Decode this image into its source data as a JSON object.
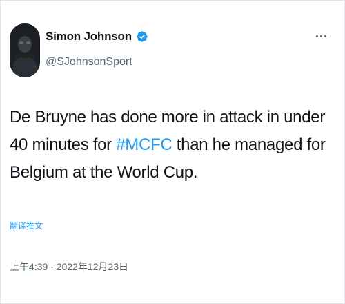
{
  "author": {
    "display_name": "Simon Johnson",
    "handle": "@SJohnsonSport",
    "verified": true
  },
  "tweet": {
    "text_before": "De Bruyne has done more in attack in under 40 minutes for ",
    "hashtag": "#MCFC",
    "text_after": " than he managed for Belgium at the World Cup.",
    "translate_label": "翻译推文",
    "timestamp": "上午4:39 · 2022年12月23日"
  },
  "icons": {
    "verified": "verified-badge-icon",
    "more": "more-options-icon"
  },
  "colors": {
    "accent": "#1d9bf0",
    "text_primary": "#0f1419",
    "text_secondary": "#536471"
  }
}
